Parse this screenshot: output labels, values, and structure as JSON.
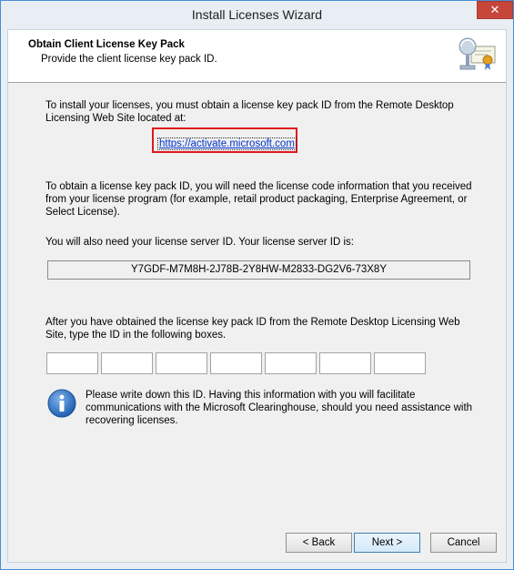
{
  "window": {
    "title": "Install Licenses Wizard",
    "close_glyph": "✕"
  },
  "header": {
    "title": "Obtain Client License Key Pack",
    "subtitle": "Provide the client license key pack ID.",
    "icon": "certificate-icon"
  },
  "body": {
    "intro": "To install your licenses, you must obtain a license key pack ID from the Remote Desktop Licensing Web Site located at:",
    "link": "https://activate.microsoft.com",
    "obtain_text": "To obtain a license key pack ID, you will need the license code information that you received from your license program (for example, retail product packaging, Enterprise Agreement, or Select License).",
    "server_id_label": "You will also need your license server ID. Your license server ID is:",
    "server_id": "Y7GDF-M7M8H-2J78B-2Y8HW-M2833-DG2V6-73X8Y",
    "type_id_text": "After you have obtained the license key pack ID from the Remote Desktop Licensing Web Site, type the ID in the following boxes.",
    "key_boxes": [
      "",
      "",
      "",
      "",
      "",
      "",
      "",
      ""
    ],
    "note": "Please write down this ID. Having this information with you will facilitate communications with the Microsoft Clearinghouse, should you need assistance with recovering licenses.",
    "note_icon": "info-icon"
  },
  "buttons": {
    "back": "< Back",
    "next": "Next >",
    "cancel": "Cancel"
  },
  "colors": {
    "link": "#0033cc",
    "highlight_box": "#e1181e",
    "close": "#c7463a"
  }
}
